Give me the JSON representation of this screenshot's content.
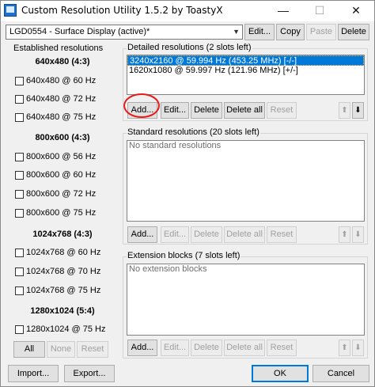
{
  "window": {
    "title": "Custom Resolution Utility 1.5.2 by ToastyX"
  },
  "title_controls": {
    "minimize": "—",
    "maximize": "☐",
    "close": "✕"
  },
  "toolbar": {
    "display_selected": "LGD0554 - Surface Display (active)*",
    "edit_label": "Edit...",
    "copy_label": "Copy",
    "paste_label": "Paste",
    "delete_label": "Delete"
  },
  "established": {
    "header": "Established resolutions",
    "groups": [
      {
        "title": "640x480 (4:3)",
        "items": [
          "640x480 @ 60 Hz",
          "640x480 @ 72 Hz",
          "640x480 @ 75 Hz"
        ]
      },
      {
        "title": "800x600 (4:3)",
        "items": [
          "800x600 @ 56 Hz",
          "800x600 @ 60 Hz",
          "800x600 @ 72 Hz",
          "800x600 @ 75 Hz"
        ]
      },
      {
        "title": "1024x768 (4:3)",
        "items": [
          "1024x768 @ 60 Hz",
          "1024x768 @ 70 Hz",
          "1024x768 @ 75 Hz"
        ]
      },
      {
        "title": "1280x1024 (5:4)",
        "items": [
          "1280x1024 @ 75 Hz"
        ]
      }
    ],
    "all_label": "All",
    "none_label": "None",
    "reset_label": "Reset"
  },
  "detailed": {
    "label": "Detailed resolutions (2 slots left)",
    "items": [
      "3240x2160 @ 59.994 Hz (453.25 MHz) [-/-]",
      "1620x1080 @ 59.997 Hz (121.96 MHz) [+/-]"
    ],
    "add": "Add...",
    "edit": "Edit...",
    "delete": "Delete",
    "delete_all": "Delete all",
    "reset": "Reset",
    "up": "⬆",
    "down": "⬇"
  },
  "standard": {
    "label": "Standard resolutions (20 slots left)",
    "empty": "No standard resolutions",
    "add": "Add...",
    "edit": "Edit...",
    "delete": "Delete",
    "delete_all": "Delete all",
    "reset": "Reset",
    "up": "⬆",
    "down": "⬇"
  },
  "extension": {
    "label": "Extension blocks (7 slots left)",
    "empty": "No extension blocks",
    "add": "Add...",
    "edit": "Edit...",
    "delete": "Delete",
    "delete_all": "Delete all",
    "reset": "Reset",
    "up": "⬆",
    "down": "⬇"
  },
  "footer": {
    "import": "Import...",
    "export": "Export...",
    "ok": "OK",
    "cancel": "Cancel"
  },
  "colors": {
    "selection": "#0078d7",
    "annotation": "#e81818"
  }
}
